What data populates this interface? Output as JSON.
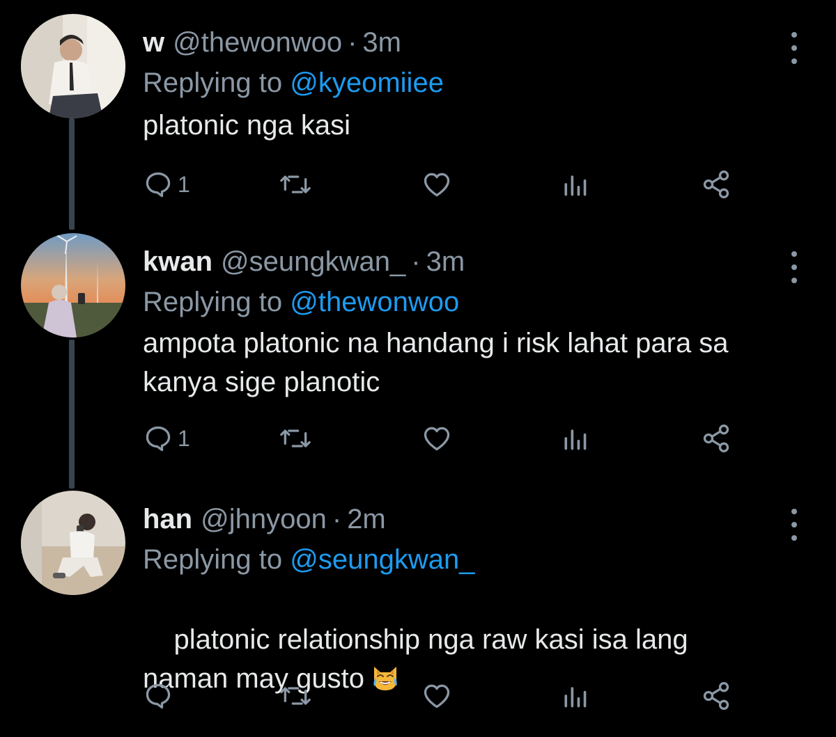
{
  "colors": {
    "background": "#000000",
    "text_primary": "#e7e9ea",
    "text_secondary": "#8b98a5",
    "link": "#1d9bf0",
    "thread_line": "#38444d"
  },
  "tweets": [
    {
      "name": "w",
      "handle": "@thewonwoo",
      "separator": "·",
      "time": "3m",
      "replying_prefix": "Replying to",
      "replying_to": "@kyeomiiee",
      "text": "platonic nga kasi",
      "reply_count": "1",
      "avatar": "avatar-photo-person-sitting"
    },
    {
      "name": "kwan",
      "handle": "@seungkwan_",
      "separator": "·",
      "time": "3m",
      "replying_prefix": "Replying to",
      "replying_to": "@thewonwoo",
      "text": "ampota platonic na handang i risk lahat para sa kanya sige planotic",
      "reply_count": "1",
      "avatar": "avatar-photo-sunset-windmill"
    },
    {
      "name": "han",
      "handle": "@jhnyoon",
      "separator": "·",
      "time": "2m",
      "replying_prefix": "Replying to",
      "replying_to": "@seungkwan_",
      "text": "platonic relationship nga raw kasi isa lang naman may gusto",
      "reply_count": "",
      "avatar": "avatar-photo-person-crouching",
      "emoji": "cat-face-with-tears-of-joy"
    }
  ],
  "icons": {
    "reply": "reply-icon",
    "retweet": "retweet-icon",
    "like": "heart-icon",
    "views": "analytics-icon",
    "share": "share-icon",
    "more": "more-icon"
  }
}
